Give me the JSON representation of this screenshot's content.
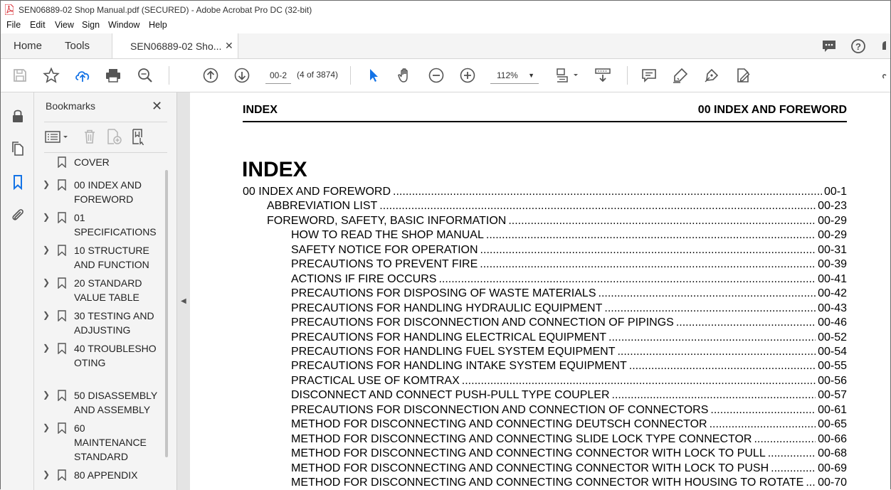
{
  "window": {
    "title": "SEN06889-02 Shop Manual.pdf (SECURED) - Adobe Acrobat Pro DC (32-bit)"
  },
  "menu": [
    "File",
    "Edit",
    "View",
    "Sign",
    "Window",
    "Help"
  ],
  "tabs": {
    "home": "Home",
    "tools": "Tools",
    "document": "SEN06889-02 Sho..."
  },
  "toolbar": {
    "page_input": "00-2",
    "page_count": "(4 of 3874)",
    "zoom": "112%"
  },
  "bookmarks": {
    "title": "Bookmarks",
    "items": [
      {
        "label": "COVER",
        "expandable": false
      },
      {
        "label": "00 INDEX AND FOREWORD",
        "expandable": true
      },
      {
        "label": "01 SPECIFICATIONS",
        "expandable": true
      },
      {
        "label": "10 STRUCTURE AND FUNCTION",
        "expandable": true
      },
      {
        "label": "20 STANDARD VALUE TABLE",
        "expandable": true
      },
      {
        "label": "30 TESTING AND ADJUSTING",
        "expandable": true
      },
      {
        "label": "40 TROUBLESHOOTING",
        "expandable": true
      },
      {
        "label": "50 DISASSEMBLY AND ASSEMBLY",
        "expandable": true
      },
      {
        "label": "60 MAINTENANCE STANDARD",
        "expandable": true
      },
      {
        "label": "80 APPENDIX",
        "expandable": true
      }
    ]
  },
  "document": {
    "header_left": "INDEX",
    "header_right": "00 INDEX AND FOREWORD",
    "heading": "INDEX",
    "toc": [
      {
        "level": 0,
        "title": "00 INDEX AND FOREWORD",
        "page": "00-1"
      },
      {
        "level": 1,
        "title": "ABBREVIATION LIST",
        "page": "00-23"
      },
      {
        "level": 1,
        "title": "FOREWORD, SAFETY, BASIC INFORMATION",
        "page": "00-29"
      },
      {
        "level": 2,
        "title": "HOW TO READ THE SHOP MANUAL",
        "page": "00-29"
      },
      {
        "level": 2,
        "title": "SAFETY NOTICE FOR OPERATION",
        "page": "00-31"
      },
      {
        "level": 2,
        "title": "PRECAUTIONS TO PREVENT FIRE",
        "page": "00-39"
      },
      {
        "level": 2,
        "title": "ACTIONS IF FIRE OCCURS",
        "page": "00-41"
      },
      {
        "level": 2,
        "title": "PRECAUTIONS FOR DISPOSING OF WASTE MATERIALS",
        "page": "00-42"
      },
      {
        "level": 2,
        "title": "PRECAUTIONS FOR HANDLING HYDRAULIC EQUIPMENT",
        "page": "00-43"
      },
      {
        "level": 2,
        "title": "PRECAUTIONS FOR DISCONNECTION AND CONNECTION OF PIPINGS",
        "page": "00-46"
      },
      {
        "level": 2,
        "title": "PRECAUTIONS FOR HANDLING ELECTRICAL EQUIPMENT",
        "page": "00-52"
      },
      {
        "level": 2,
        "title": "PRECAUTIONS FOR HANDLING FUEL SYSTEM EQUIPMENT",
        "page": "00-54"
      },
      {
        "level": 2,
        "title": "PRECAUTIONS FOR HANDLING INTAKE SYSTEM EQUIPMENT",
        "page": "00-55"
      },
      {
        "level": 2,
        "title": "PRACTICAL USE OF KOMTRAX",
        "page": "00-56"
      },
      {
        "level": 2,
        "title": "DISCONNECT AND CONNECT PUSH-PULL TYPE COUPLER",
        "page": "00-57"
      },
      {
        "level": 2,
        "title": "PRECAUTIONS FOR DISCONNECTION AND CONNECTION OF CONNECTORS",
        "page": "00-61"
      },
      {
        "level": 2,
        "title": "METHOD FOR DISCONNECTING AND CONNECTING DEUTSCH CONNECTOR",
        "page": "00-65"
      },
      {
        "level": 2,
        "title": "METHOD FOR DISCONNECTING AND CONNECTING SLIDE LOCK TYPE CONNECTOR",
        "page": "00-66"
      },
      {
        "level": 2,
        "title": "METHOD FOR DISCONNECTING AND CONNECTING CONNECTOR WITH LOCK TO PULL",
        "page": "00-68"
      },
      {
        "level": 2,
        "title": "METHOD FOR DISCONNECTING AND CONNECTING CONNECTOR WITH LOCK TO PUSH",
        "page": "00-69"
      },
      {
        "level": 2,
        "title": "METHOD FOR DISCONNECTING AND CONNECTING CONNECTOR WITH HOUSING TO ROTATE",
        "page": "00-70"
      }
    ]
  },
  "colors": {
    "accent": "#1473e6",
    "pdf_red": "#d7282f"
  }
}
